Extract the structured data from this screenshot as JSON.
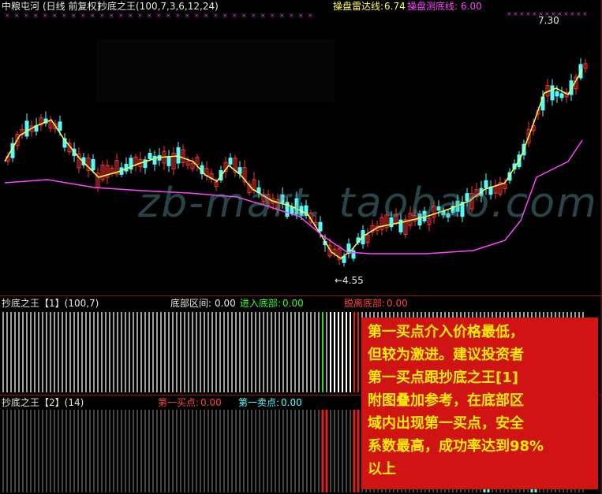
{
  "main": {
    "stock": "中粮屯河",
    "period": "(日线 前复权)",
    "indicator": "抄底之王(100,7,3,6,12,24)",
    "radar_label": "操盘雷达线:",
    "radar_value": "6.74",
    "bottom_label": "操盘测底线:",
    "bottom_value": "6.00",
    "high_price": "7.30",
    "low_price": "←4.55",
    "watermark": "zb-mart. taobao.com"
  },
  "panel1": {
    "title": "抄底之王【1】(100,7)",
    "zone_label": "底部区间:",
    "zone_value": "0.00",
    "enter_label": "进入底部:",
    "enter_value": "0.00",
    "leave_label": "脱离底部:",
    "leave_value": "0.00"
  },
  "panel2": {
    "title": "抄底之王【2】(14)",
    "buy_label": "第一买点:",
    "buy_value": "0.00",
    "sell_label": "第一卖点:",
    "sell_value": "0.00"
  },
  "note": {
    "lines": [
      "第一买点介入价格最低，",
      "但较为激进。建议投资者",
      "第一买点跟抄底之王[1]",
      "附图叠加参考，在底部区",
      "域内出现第一买点，安全",
      "系数最高，成功率达到98%",
      "以上"
    ]
  },
  "colors": {
    "up": "#ff3232",
    "down": "#54ffff",
    "ma_fast": "#ffff55",
    "ma_slow": "#ff44ff",
    "panel_bar": "#a0a0a0",
    "note_bg": "#d01414",
    "note_text": "#ffee00"
  }
}
